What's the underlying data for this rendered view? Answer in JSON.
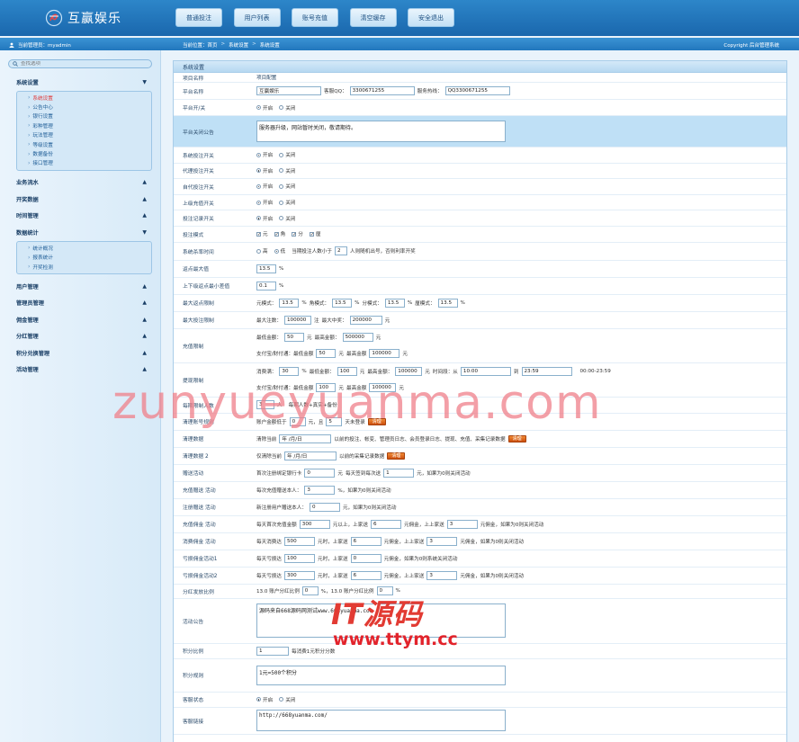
{
  "header": {
    "logo_text": "互赢娱乐",
    "nav": [
      "普通投注",
      "用户列表",
      "账号充值",
      "清空缓存",
      "安全退出"
    ]
  },
  "bar": {
    "user_info": "当前管理员：myadmin",
    "breadcrumb": [
      "当前位置：首页",
      "系统设置",
      "系统设置"
    ],
    "copyright": "Copyright 后台管理系统"
  },
  "sidebar": {
    "search_placeholder": "查找选项",
    "groups": [
      {
        "label": "系统设置",
        "arrow": "▼",
        "items": [
          "系统设置",
          "公告中心",
          "银行设置",
          "彩种管理",
          "玩法管理",
          "等级设置",
          "数据备份",
          "接口管理"
        ]
      },
      {
        "label": "业务流水",
        "arrow": "▲",
        "items": []
      },
      {
        "label": "开奖数据",
        "arrow": "▲",
        "items": []
      },
      {
        "label": "时间管理",
        "arrow": "▲",
        "items": []
      },
      {
        "label": "数据统计",
        "arrow": "▼",
        "items": [
          "统计概况",
          "报表统计",
          "开奖检测"
        ]
      },
      {
        "label": "用户管理",
        "arrow": "▲",
        "items": []
      },
      {
        "label": "管理员管理",
        "arrow": "▲",
        "items": []
      },
      {
        "label": "佣金管理",
        "arrow": "▲",
        "items": []
      },
      {
        "label": "分红管理",
        "arrow": "▲",
        "items": []
      },
      {
        "label": "积分兑换管理",
        "arrow": "▲",
        "items": []
      },
      {
        "label": "活动管理",
        "arrow": "▲",
        "items": []
      }
    ]
  },
  "main": {
    "title": "系统设置",
    "head": {
      "label": "项目名称",
      "value": "项目配置"
    },
    "site_name": {
      "label": "平台名称",
      "value": "互赢娱乐",
      "qq_label": "客服QQ：",
      "qq": "3300671255",
      "hotline_label": "服务热线：",
      "hotline": "QQ3300671255"
    },
    "switch": {
      "label": "平台开/关",
      "on": "开启",
      "off": "关闭"
    },
    "close_notice": {
      "label": "平台关闭公告",
      "value": "服务器升级，网站暂时关闭，敬请期待。"
    },
    "toggles": [
      {
        "label": "系统投注开关",
        "on": "开启",
        "off": "关闭"
      },
      {
        "label": "代理投注开关",
        "on": "开启",
        "off": "关闭"
      },
      {
        "label": "自代投注开关",
        "on": "开启",
        "off": "关闭"
      },
      {
        "label": "上级充值开关",
        "on": "开启",
        "off": "关闭"
      },
      {
        "label": "投注记录开关",
        "on": "开启",
        "off": "关闭"
      }
    ],
    "bet_mode": {
      "label": "投注模式",
      "options": [
        "元",
        "角",
        "分",
        "厘"
      ]
    },
    "kill_rate": {
      "label": "系统杀率时间",
      "high": "高",
      "low": "低",
      "text1": "当期投注人数小于",
      "value": "2",
      "text2": "人则随机出号，否则利率开奖"
    },
    "rebate_max": {
      "label": "返点最大值",
      "value": "13.5",
      "unit": "%"
    },
    "rebate_min": {
      "label": "上下级返点最小差值",
      "value": "0.1",
      "unit": "%"
    },
    "max_rebate": {
      "label": "最大返点限制",
      "items": [
        {
          "label": "元模式：",
          "value": "13.5"
        },
        {
          "label": "角模式：",
          "value": "13.5"
        },
        {
          "label": "分模式：",
          "value": "13.5"
        },
        {
          "label": "厘模式：",
          "value": "13.5"
        }
      ],
      "unit": "%"
    },
    "max_bet": {
      "label": "最大投注限制",
      "count_label": "最大注数：",
      "count": "100000",
      "count_unit": "注",
      "win_label": "最大中奖：",
      "win": "200000",
      "win_unit": "元"
    },
    "recharge": {
      "label": "充值限制",
      "min_label": "最低金额：",
      "min": "50",
      "max_label": "最高金额：",
      "max": "500000",
      "unit": "元",
      "alt_label": "支付宝/财付通：最低金额",
      "alt_min": "50",
      "alt_max_label": "最高金额",
      "alt_max": "100000"
    },
    "withdraw": {
      "label": "提现限制",
      "times_label": "消费满：",
      "times": "30",
      "min_label": "最低金额：",
      "min": "100",
      "max_label": "最高金额：",
      "max": "100000",
      "time_label": "时间段：从",
      "from": "10:00",
      "to_label": "到",
      "to": "23:59",
      "hint": "00:00-23:59",
      "alt_label": "支付宝/财付通：最低金额",
      "alt_min": "100",
      "alt_max_label": "最高金额",
      "alt_max": "100000"
    },
    "guest_limit": {
      "label": "每期限制人数",
      "value": "3",
      "unit": "人",
      "hint": "每期人数+真实+备份"
    },
    "clean_account": {
      "label": "清理账号规则",
      "text1": "账户金额低于",
      "v1": "0",
      "text2": "元，且",
      "v2": "5",
      "text3": "天未登录",
      "btn": "清理"
    },
    "clean_data": {
      "label": "清理数据",
      "text1": "清除当前",
      "date": "年 /月/日",
      "text2": "以前的投注、帐变、管理员日志、会员登录日志、提现、充值、采集记录数据",
      "btn": "清理"
    },
    "clean_data2": {
      "label": "清理数据 2",
      "text1": "仅清除当前",
      "date": "年 /月/日",
      "text2": "以前的采集记录数据",
      "btn": "清理"
    },
    "sign_in": {
      "label": "赠送活动",
      "text1": "首次注册绑定银行卡",
      "v1": "0",
      "text2": "元",
      "text3": "每天签到每次送",
      "v2": "1",
      "text4": "元，如果为0则关闭活动"
    },
    "rebate_act": {
      "label": "充值赠送 活动",
      "text1": "每次充值赠送本人：",
      "v": "3",
      "text2": "%，如果为0则关闭活动"
    },
    "register_act": {
      "label": "注册赠送 活动",
      "text1": "新注册用户赠送本人：",
      "v": "0",
      "text2": "元，如果为0则关闭活动"
    },
    "recharge_comm": {
      "label": "充值佣金 活动",
      "text1": "每天首次充值金额",
      "v1": "300",
      "text2": "元以上，上家送",
      "v2": "6",
      "text3": "元佣金，上上家送",
      "v3": "3",
      "text4": "元佣金，如果为0则关闭活动"
    },
    "consume_comm": {
      "label": "消费佣金 活动",
      "text1": "每天消费达",
      "v1": "500",
      "text2": "元时，上家送",
      "v2": "6",
      "text3": "元佣金，上上家送",
      "v3": "3",
      "text4": "元佣金，如果为0则关闭活动"
    },
    "loss_comm": {
      "label": "亏损佣金活动1",
      "text1": "每天亏损达",
      "v1": "100",
      "text2": "元时，上家送",
      "v2": "0",
      "text3": "元佣金，如果为0则系统关闭活动"
    },
    "loss_comm2": {
      "label": "亏损佣金活动2",
      "text1": "每天亏损达",
      "v1": "300",
      "text2": "元时，上家送",
      "v2": "6",
      "text3": "元佣金，上上家送",
      "v3": "3",
      "text4": "元佣金，如果为0则关闭活动"
    },
    "dividend": {
      "label": "分红发放比例",
      "text1": "13.0 账户分红比例",
      "v1": "0",
      "text2": "%，13.0 账户分红比例",
      "v2": "0",
      "text3": "%"
    },
    "activity_notice": {
      "label": "活动公告",
      "value": "源码来自668源码网测试www.668yuanma.com"
    },
    "points_ratio": {
      "label": "积分比例",
      "value": "1",
      "text": "每消费1元积分分数"
    },
    "points_rule": {
      "label": "积分规则",
      "value": "1元=500个积分"
    },
    "service": {
      "label": "客服状态",
      "on": "开启",
      "off": "关闭"
    },
    "service_link": {
      "label": "客服链接",
      "value": "http://668yuanma.com/"
    }
  },
  "watermark": {
    "main": "zunyueyuanma.com",
    "logo": "IT源码",
    "site": "www.ttym.cc"
  }
}
